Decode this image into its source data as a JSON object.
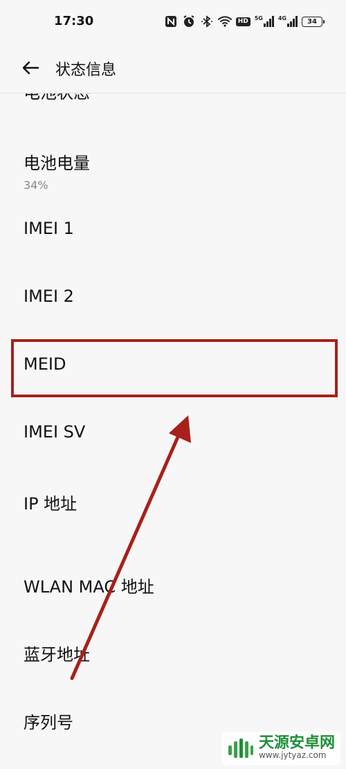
{
  "status_bar": {
    "time": "17:30",
    "net1": "5G",
    "net2": "4G",
    "hd": "HD",
    "battery": "34"
  },
  "header": {
    "back_icon": "arrow-left-icon",
    "title": "状态信息"
  },
  "list": {
    "partial_top_label": "电池状态",
    "items": [
      {
        "title": "电池电量",
        "value": "34%"
      },
      {
        "title": "IMEI 1"
      },
      {
        "title": "IMEI 2"
      },
      {
        "title": "MEID"
      },
      {
        "title": "IMEI SV"
      },
      {
        "title": "IP 地址"
      },
      {
        "title": "WLAN MAC 地址"
      },
      {
        "title": "蓝牙地址"
      },
      {
        "title": "序列号"
      }
    ]
  },
  "annotations": {
    "highlight_color": "#a8201a",
    "arrow_color": "#a8201a"
  },
  "watermark": {
    "title": "天源安卓网",
    "url": "www.jytyaz.com"
  }
}
